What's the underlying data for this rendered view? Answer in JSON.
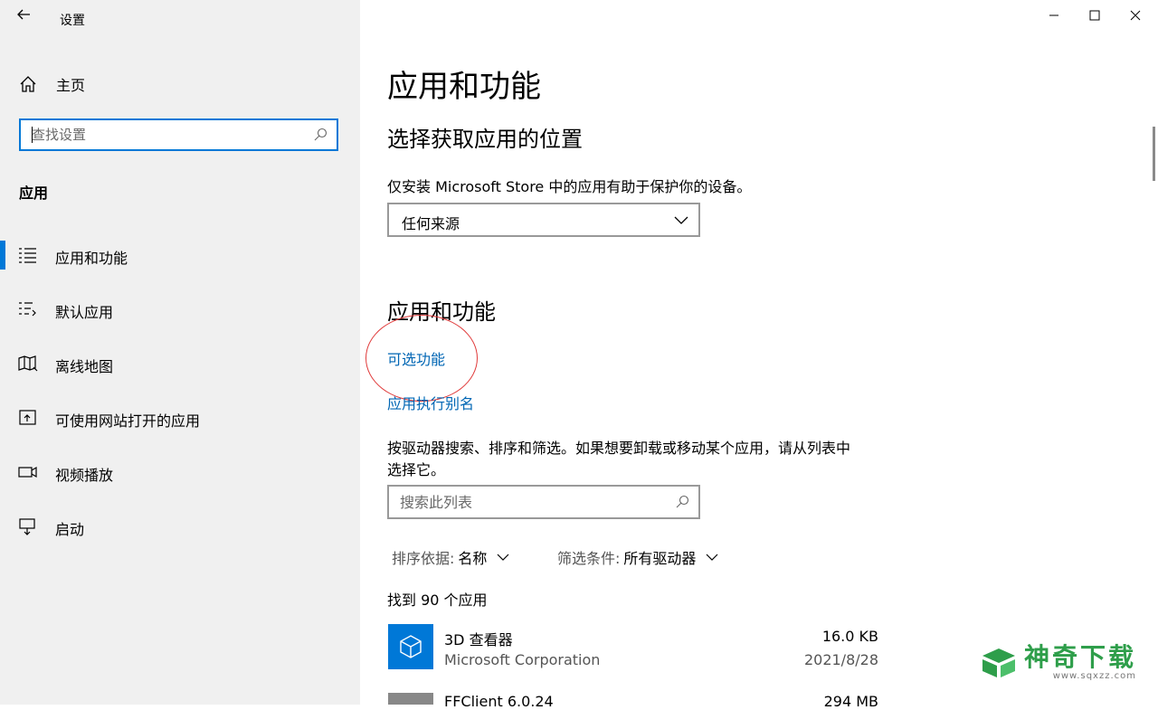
{
  "window": {
    "title": "设置"
  },
  "sidebar": {
    "home_label": "主页",
    "search_placeholder": "查找设置",
    "section_label": "应用",
    "items": [
      {
        "label": "应用和功能",
        "icon": "apps-list-icon",
        "selected": true
      },
      {
        "label": "默认应用",
        "icon": "default-apps-icon",
        "selected": false
      },
      {
        "label": "离线地图",
        "icon": "offline-map-icon",
        "selected": false
      },
      {
        "label": "可使用网站打开的应用",
        "icon": "web-open-icon",
        "selected": false
      },
      {
        "label": "视频播放",
        "icon": "video-icon",
        "selected": false
      },
      {
        "label": "启动",
        "icon": "startup-icon",
        "selected": false
      }
    ]
  },
  "main": {
    "page_title": "应用和功能",
    "source_heading": "选择获取应用的位置",
    "source_desc": "仅安装 Microsoft Store 中的应用有助于保护你的设备。",
    "source_value": "任何来源",
    "apps_heading": "应用和功能",
    "link_optional": "可选功能",
    "link_alias": "应用执行别名",
    "desc_line1": "按驱动器搜索、排序和筛选。如果想要卸载或移动某个应用，请从列表中",
    "desc_line2": "选择它。",
    "list_search_placeholder": "搜索此列表",
    "sort_label": "排序依据:",
    "sort_value": "名称",
    "filter_label": "筛选条件:",
    "filter_value": "所有驱动器",
    "found_text": "找到 90 个应用",
    "apps": [
      {
        "name": "3D 查看器",
        "publisher": "Microsoft Corporation",
        "size": "16.0 KB",
        "date": "2021/8/28"
      },
      {
        "name": "FFClient 6.0.24",
        "size": "294 MB"
      }
    ]
  },
  "watermark": {
    "title": "神奇下载",
    "url": "www.sqxzz.com"
  },
  "colors": {
    "accent": "#0078d7",
    "link": "#0066b4",
    "annotation": "#e03b3b"
  }
}
